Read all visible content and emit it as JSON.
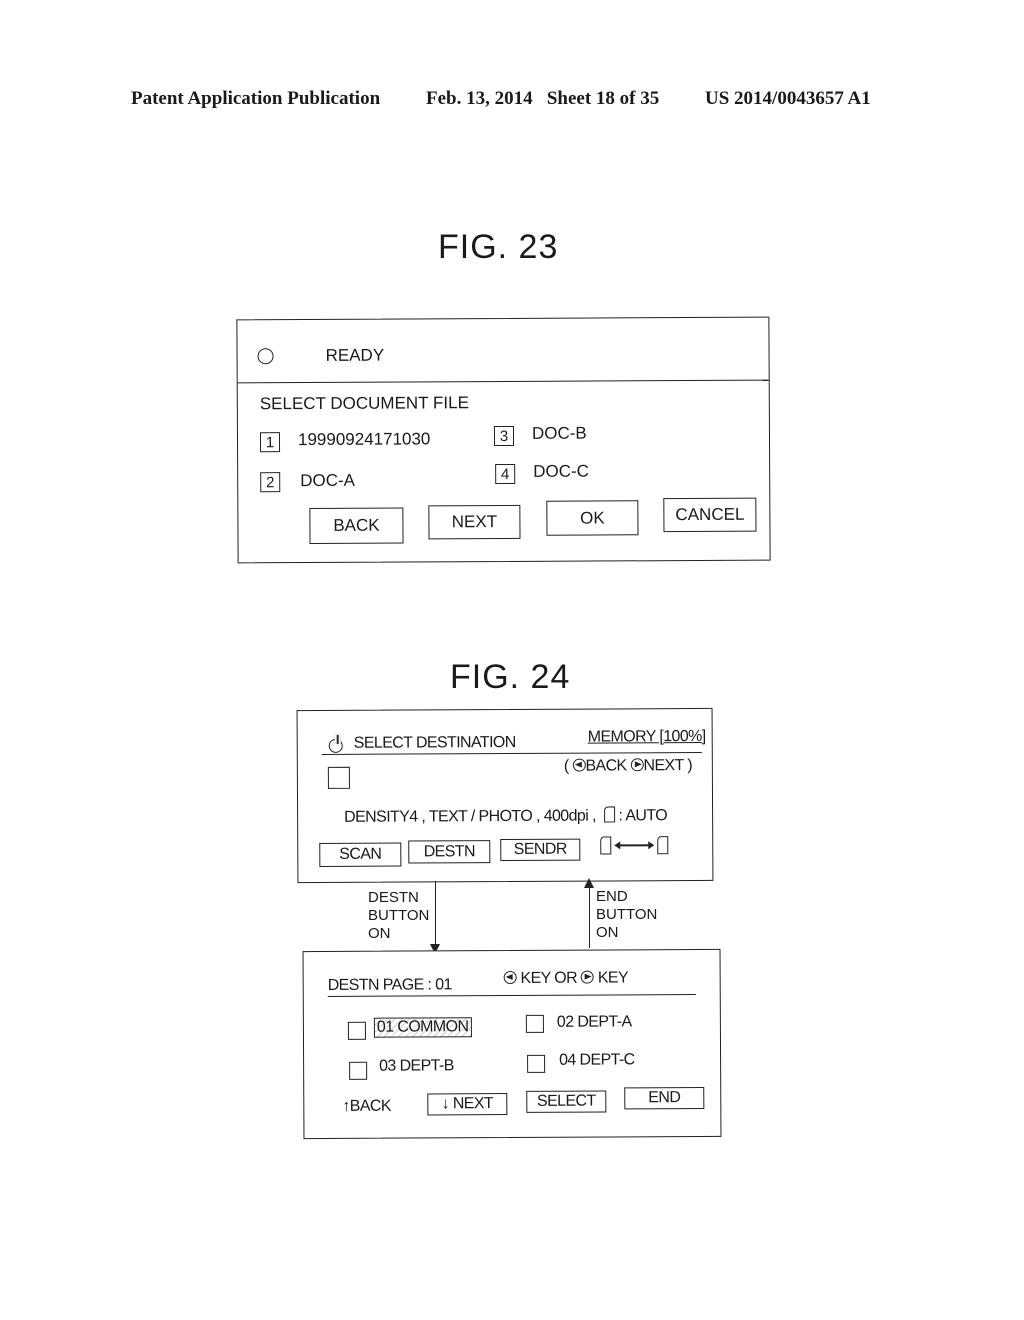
{
  "header": {
    "publication": "Patent Application Publication",
    "date_sheet": "Feb. 13, 2014   Sheet 18 of 35",
    "number": "US 2014/0043657 A1"
  },
  "fig23": {
    "title": "FIG. 23",
    "status_icon": "circle-icon",
    "status": "READY",
    "prompt": "SELECT DOCUMENT FILE",
    "files": [
      {
        "num": "1",
        "name": "19990924171030"
      },
      {
        "num": "2",
        "name": "DOC-A"
      },
      {
        "num": "3",
        "name": "DOC-B"
      },
      {
        "num": "4",
        "name": "DOC-C"
      }
    ],
    "buttons": {
      "back": "BACK",
      "next": "NEXT",
      "ok": "OK",
      "cancel": "CANCEL"
    }
  },
  "fig24": {
    "title": "FIG. 24",
    "screen1": {
      "power_icon": "power-icon",
      "title": "SELECT DESTINATION",
      "memory": "MEMORY [100%]",
      "nav_open": "(",
      "nav_back": "BACK",
      "nav_next": "NEXT",
      "nav_close": ")",
      "settings": "DENSITY4 , TEXT / PHOTO , 400dpi ,",
      "paper_setting": ": AUTO",
      "buttons": {
        "scan": "SCAN",
        "destn": "DESTN",
        "sendr": "SENDR"
      },
      "duplex_icon": "page-1-to-page-2-icon"
    },
    "transitions": {
      "down_label": [
        "DESTN",
        "BUTTON",
        "ON"
      ],
      "up_label": [
        "END",
        "BUTTON",
        "ON"
      ]
    },
    "screen2": {
      "page_label": "DESTN PAGE : 01",
      "key_hint_left": "KEY OR",
      "key_hint_right": "KEY",
      "destinations": [
        {
          "label": "01 COMMON",
          "highlighted": true
        },
        {
          "label": "02 DEPT-A",
          "highlighted": false
        },
        {
          "label": "03 DEPT-B",
          "highlighted": false
        },
        {
          "label": "04 DEPT-C",
          "highlighted": false
        }
      ],
      "back": "↑BACK",
      "buttons": {
        "next": "↓ NEXT",
        "select": "SELECT",
        "end": "END"
      }
    }
  }
}
